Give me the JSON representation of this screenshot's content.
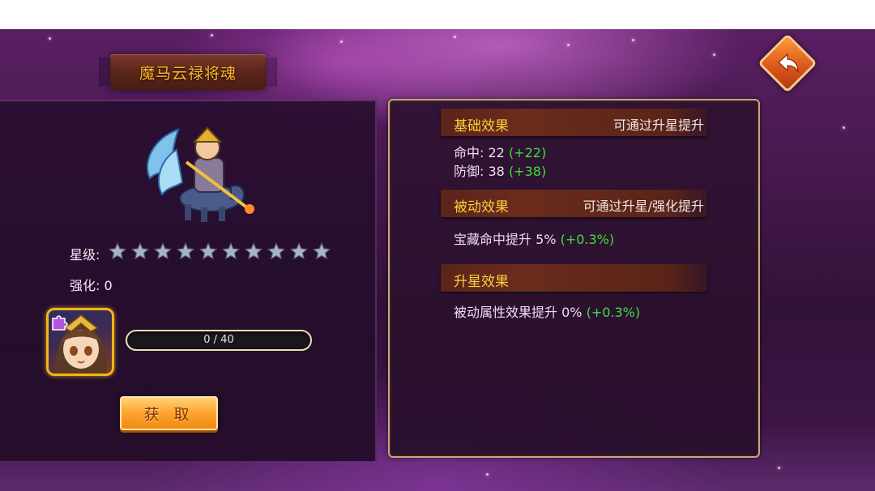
{
  "title": "魔马云禄将魂",
  "hero": {
    "star_label": "星级:",
    "star_count": 10,
    "stars_filled": 0,
    "enhance_label": "强化: 0"
  },
  "progress": {
    "current": 0,
    "max": 40,
    "text": "0 / 40"
  },
  "obtain_button": "获 取",
  "sections": {
    "basic": {
      "title": "基础效果",
      "hint": "可通过升星提升",
      "stats": [
        {
          "label": "命中: 22",
          "bonus": "(+22)"
        },
        {
          "label": "防御: 38",
          "bonus": "(+38)"
        }
      ]
    },
    "passive": {
      "title": "被动效果",
      "hint": "可通过升星/强化提升",
      "stats": [
        {
          "label": "宝藏命中提升 5%",
          "bonus": "(+0.3%)"
        }
      ]
    },
    "star_up": {
      "title": "升星效果",
      "hint": "",
      "stats": [
        {
          "label": "被动属性效果提升 0%",
          "bonus": "(+0.3%)"
        }
      ]
    }
  },
  "colors": {
    "title_gold": "#ffb52a",
    "section_title": "#ffcf3a",
    "bonus_green": "#3ee03a",
    "button_orange": "#ffa732",
    "frame_gold": "#c9a878"
  },
  "icons": {
    "back": "back-arrow-icon",
    "star": "star-icon",
    "puzzle": "puzzle-piece-icon"
  }
}
